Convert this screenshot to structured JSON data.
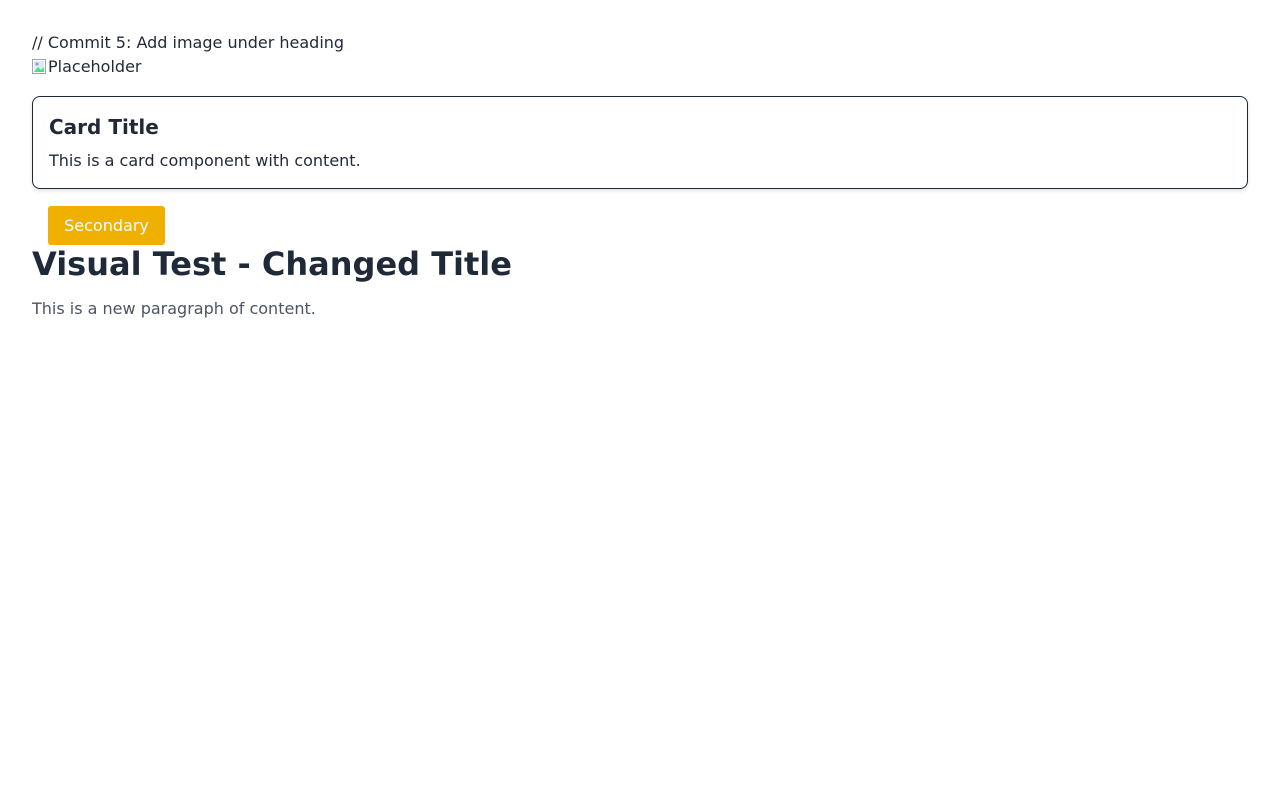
{
  "comment": {
    "text": "// Commit 5: Add image under heading"
  },
  "image": {
    "alt": "Placeholder",
    "icon": "broken-image-icon"
  },
  "card": {
    "title": "Card Title",
    "body": "This is a card component with content."
  },
  "button": {
    "label": "Secondary",
    "color": "#f0b000"
  },
  "main": {
    "heading": "Visual Test - Changed Title",
    "paragraph": "This is a new paragraph of content."
  }
}
